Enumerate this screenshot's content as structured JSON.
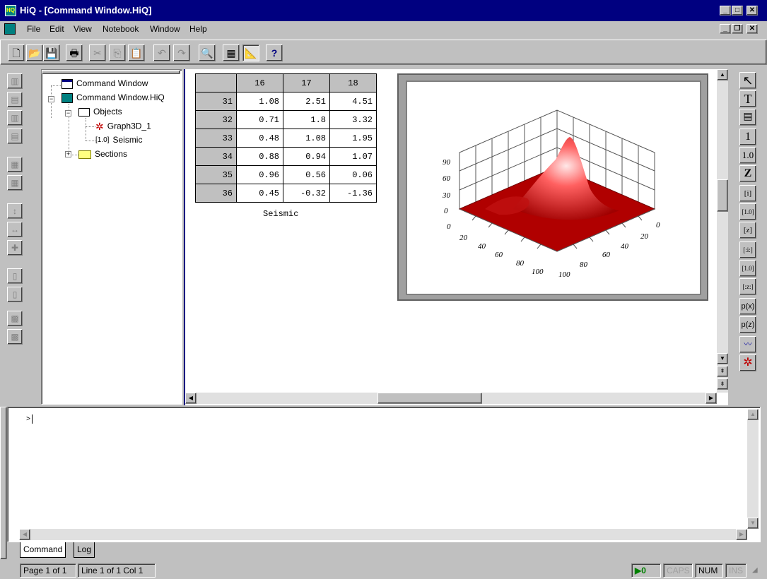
{
  "window": {
    "title": "HiQ - [Command Window.HiQ]",
    "app_icon_text": "HQ",
    "caption_buttons": [
      "_",
      "□",
      "✕"
    ]
  },
  "menu": {
    "items": [
      {
        "label": "File"
      },
      {
        "label": "Edit"
      },
      {
        "label": "View"
      },
      {
        "label": "Notebook"
      },
      {
        "label": "Window"
      },
      {
        "label": "Help"
      }
    ],
    "mdi_buttons": [
      "_",
      "❐",
      "✕"
    ]
  },
  "toolbar": {
    "buttons": [
      {
        "icon": "new-document-icon",
        "glyph": "🗋"
      },
      {
        "icon": "open-folder-icon",
        "glyph": "📂"
      },
      {
        "icon": "save-icon",
        "glyph": "💾"
      },
      {
        "icon": "print-icon",
        "glyph": "🖶"
      },
      {
        "icon": "cut-icon",
        "glyph": "✂"
      },
      {
        "icon": "copy-icon",
        "glyph": "⎘"
      },
      {
        "icon": "paste-icon",
        "glyph": "📋"
      },
      {
        "icon": "undo-icon",
        "glyph": "↶"
      },
      {
        "icon": "redo-icon",
        "glyph": "↷"
      },
      {
        "icon": "find-icon",
        "glyph": "🔍"
      },
      {
        "icon": "calculator-icon",
        "glyph": "▦"
      },
      {
        "icon": "graph-tool-icon",
        "glyph": "📐"
      },
      {
        "icon": "context-help-icon",
        "glyph": "?"
      }
    ]
  },
  "tree": {
    "items": [
      {
        "label": "Command Window"
      },
      {
        "label": "Command Window.HiQ"
      },
      {
        "label": "Objects"
      },
      {
        "label": "Graph3D_1"
      },
      {
        "label": "Seismic"
      },
      {
        "label": "Sections"
      }
    ],
    "seismic_icon_text": "[1.0]"
  },
  "table": {
    "columns": [
      "16",
      "17",
      "18"
    ],
    "rows": [
      {
        "row": "31",
        "values": [
          "1.08",
          "2.51",
          "4.51"
        ]
      },
      {
        "row": "32",
        "values": [
          "0.71",
          "1.8",
          "3.32"
        ]
      },
      {
        "row": "33",
        "values": [
          "0.48",
          "1.08",
          "1.95"
        ]
      },
      {
        "row": "34",
        "values": [
          "0.88",
          "0.94",
          "1.07"
        ]
      },
      {
        "row": "35",
        "values": [
          "0.96",
          "0.56",
          "0.06"
        ]
      },
      {
        "row": "36",
        "values": [
          "0.45",
          "-0.32",
          "-1.36"
        ]
      }
    ],
    "caption": "Seismic"
  },
  "graph3d": {
    "z_ticks": [
      "0",
      "30",
      "60",
      "90"
    ],
    "x_ticks": [
      "0",
      "20",
      "40",
      "60",
      "80",
      "100"
    ],
    "y_ticks": [
      "0",
      "20",
      "40",
      "60",
      "80",
      "100"
    ],
    "surface_color": "#b00000",
    "peak_color": "#ffe0e0"
  },
  "palette": {
    "buttons": [
      {
        "icon": "pointer-icon",
        "glyph": "↖"
      },
      {
        "icon": "text-icon",
        "glyph": "T"
      },
      {
        "icon": "textbox-icon",
        "glyph": "▤"
      },
      {
        "icon": "integer-icon",
        "glyph": "1"
      },
      {
        "icon": "real-icon",
        "glyph": "1.0"
      },
      {
        "icon": "complex-icon",
        "glyph": "Z"
      },
      {
        "icon": "int-vector-icon",
        "glyph": "[i]"
      },
      {
        "icon": "real-vector-icon",
        "glyph": "[1.0]"
      },
      {
        "icon": "complex-vector-icon",
        "glyph": "[z]"
      },
      {
        "icon": "int-matrix-icon",
        "glyph": "[:i:]"
      },
      {
        "icon": "real-matrix-icon",
        "glyph": "[1.0]"
      },
      {
        "icon": "complex-matrix-icon",
        "glyph": "[:z:]"
      },
      {
        "icon": "poly-x-icon",
        "glyph": "p(x)"
      },
      {
        "icon": "poly-z-icon",
        "glyph": "p(z)"
      },
      {
        "icon": "graph2d-icon",
        "glyph": "〰"
      },
      {
        "icon": "graph3d-icon",
        "glyph": "✲"
      }
    ]
  },
  "command": {
    "prompt": ">"
  },
  "tabs": [
    {
      "label": "Command"
    },
    {
      "label": "Log"
    }
  ],
  "status": {
    "page": "Page 1 of 1",
    "position": "Line 1 of 1  Col 1",
    "run_count": "▶0",
    "caps": "CAPS",
    "num": "NUM",
    "ins": "INS"
  }
}
